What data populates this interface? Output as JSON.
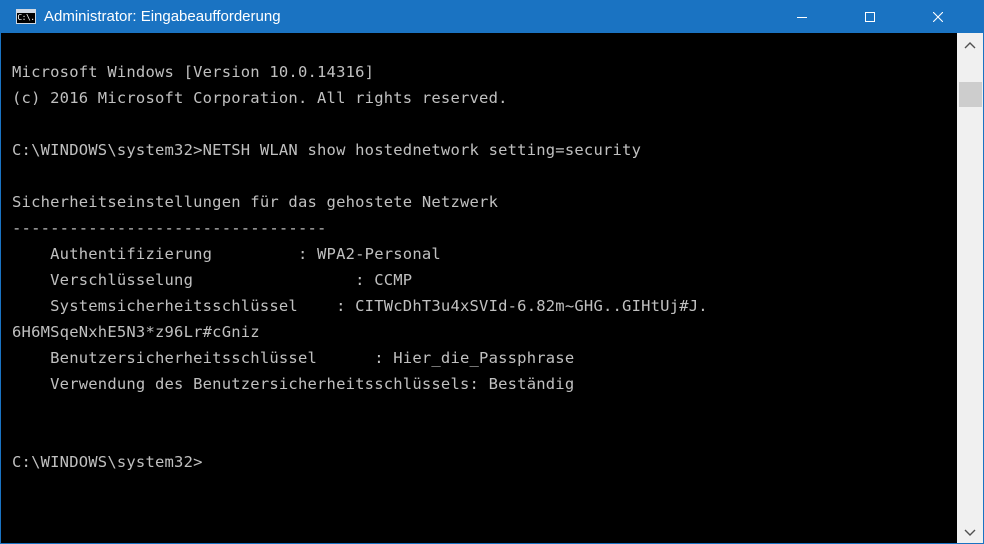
{
  "window": {
    "title": "Administrator: Eingabeaufforderung",
    "icon_text": "C:\\.",
    "icon": "cmd-icon",
    "accent_color": "#1a73c2",
    "controls": {
      "minimize_icon": "minimize-icon",
      "maximize_icon": "maximize-icon",
      "close_icon": "close-icon"
    }
  },
  "console": {
    "lines": [
      "Microsoft Windows [Version 10.0.14316]",
      "(c) 2016 Microsoft Corporation. All rights reserved.",
      "",
      "C:\\WINDOWS\\system32>NETSH WLAN show hostednetwork setting=security",
      "",
      "Sicherheitseinstellungen für das gehostete Netzwerk",
      "---------------------------------",
      "    Authentifizierung         : WPA2-Personal",
      "    Verschlüsselung                 : CCMP",
      "    Systemsicherheitsschlüssel    : CITWcDhT3u4xSVId-6.82m~GHG..GIHtUj#J.",
      "6H6MSqeNxhE5N3*z96Lr#cGniz",
      "    Benutzersicherheitsschlüssel      : Hier_die_Passphrase",
      "    Verwendung des Benutzersicherheitsschlüssels: Beständig",
      "",
      "",
      "C:\\WINDOWS\\system32>"
    ],
    "text_color": "#c0c0c0",
    "background_color": "#000000"
  },
  "scrollbar": {
    "up_icon": "scroll-up-arrow-icon",
    "down_icon": "scroll-down-arrow-icon"
  }
}
